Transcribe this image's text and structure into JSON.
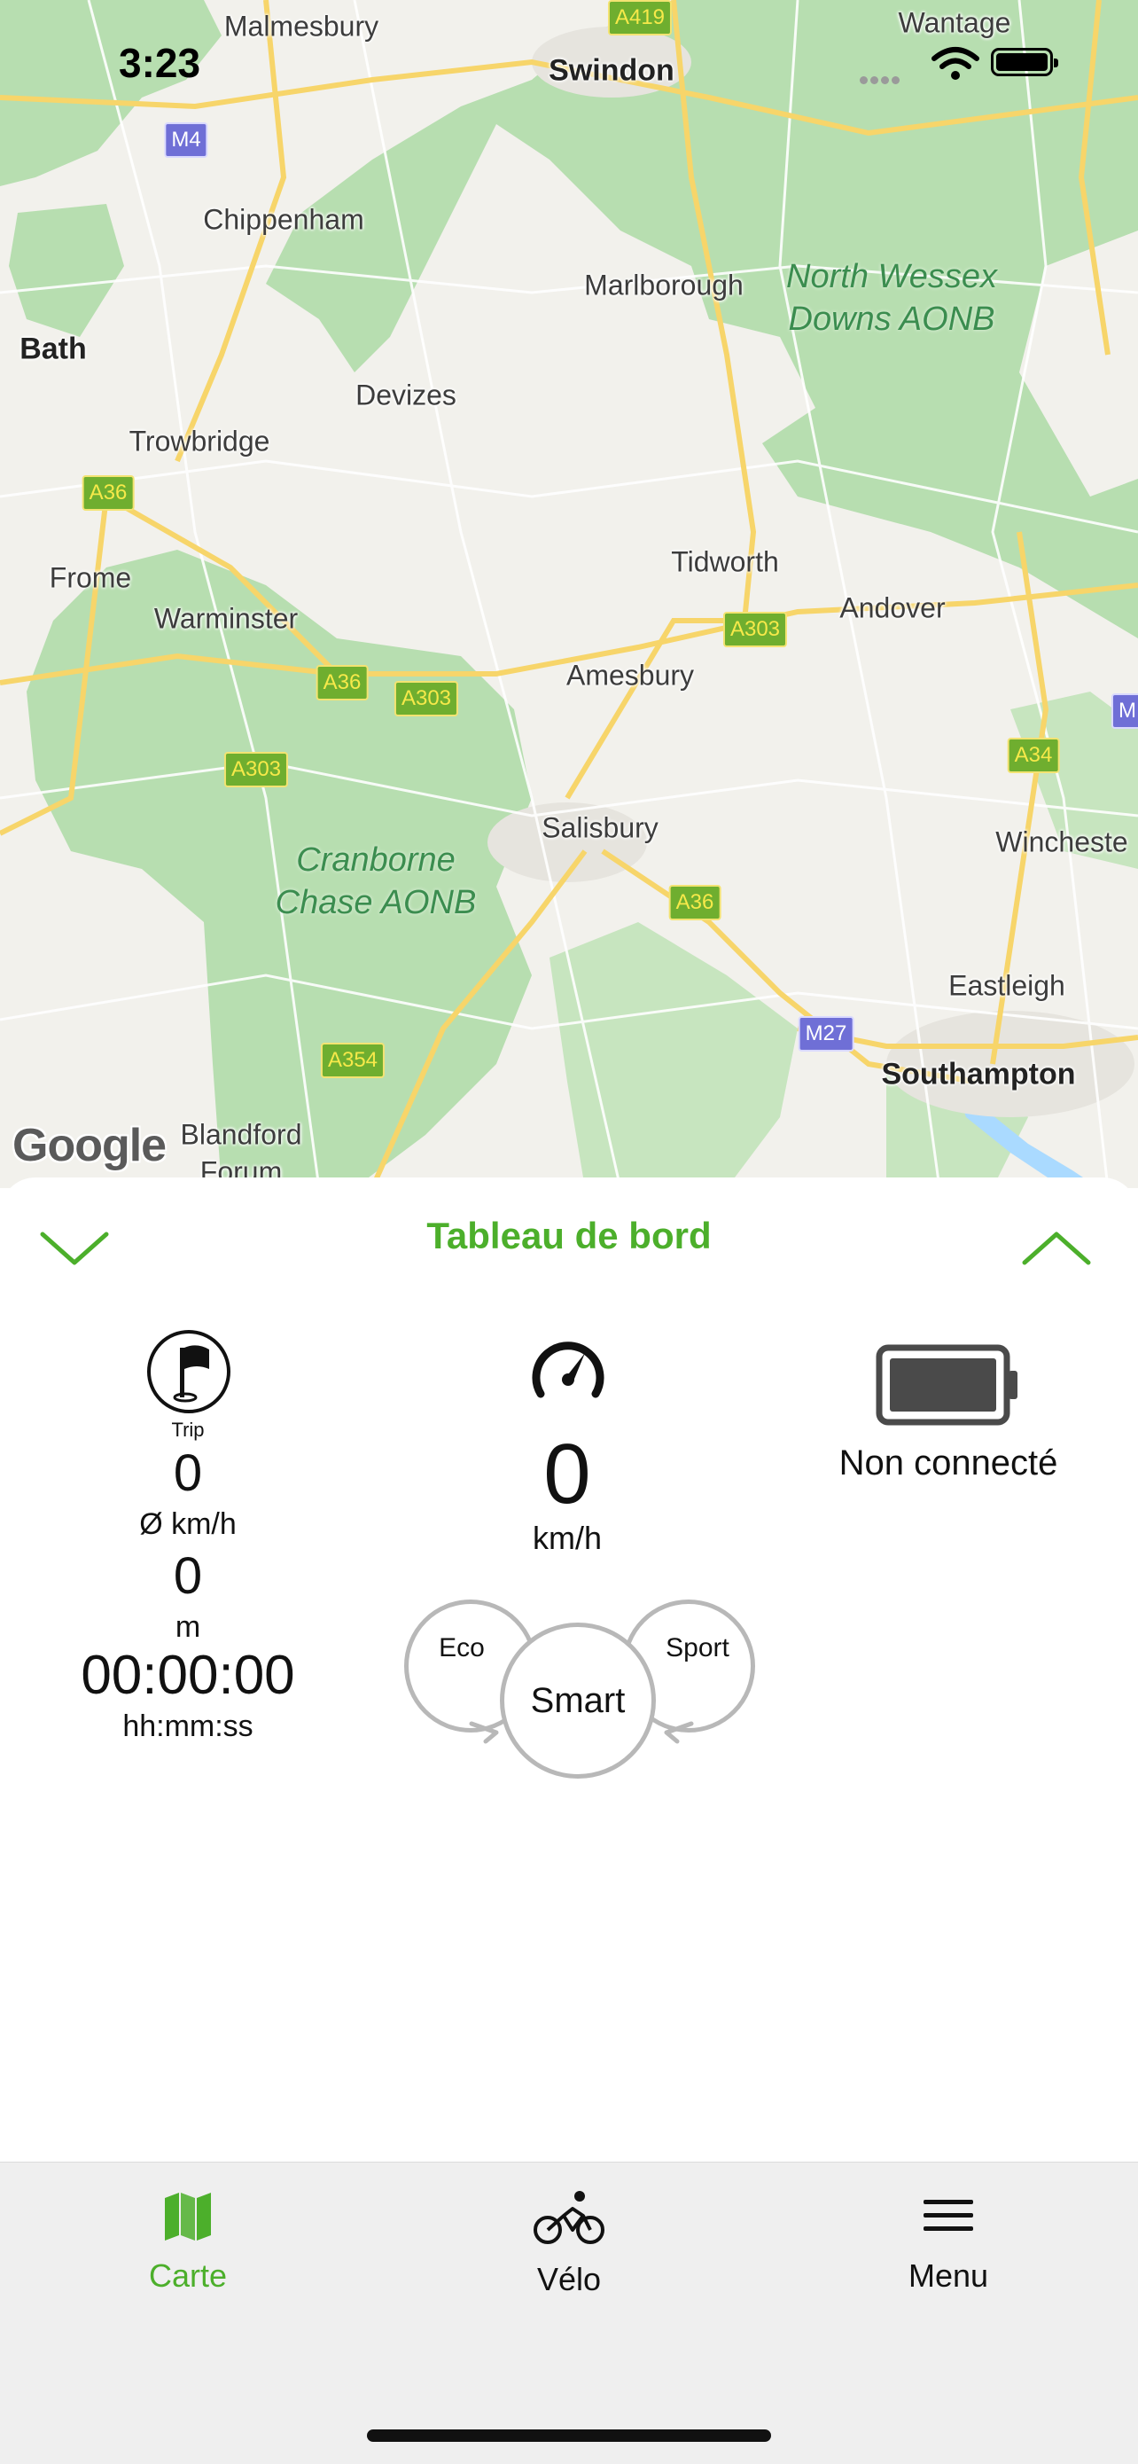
{
  "status_bar": {
    "time": "3:23"
  },
  "map": {
    "attribution": "Google",
    "places": [
      {
        "name": "Malmesbury"
      },
      {
        "name": "Swindon"
      },
      {
        "name": "Wantage"
      },
      {
        "name": "Chippenham"
      },
      {
        "name": "Marlborough"
      },
      {
        "name": "Bath"
      },
      {
        "name": "Devizes"
      },
      {
        "name": "Trowbridge"
      },
      {
        "name": "Tidworth"
      },
      {
        "name": "Frome"
      },
      {
        "name": "Warminster"
      },
      {
        "name": "Andover"
      },
      {
        "name": "Amesbury"
      },
      {
        "name": "Salisbury"
      },
      {
        "name": "Wincheste"
      },
      {
        "name": "Eastleigh"
      },
      {
        "name": "Southampton"
      },
      {
        "name": "Blandford"
      },
      {
        "name": "Forum"
      }
    ],
    "areas": [
      {
        "line1": "North Wessex",
        "line2": "Downs AONB"
      },
      {
        "line1": "Cranborne",
        "line2": "Chase AONB"
      }
    ],
    "roads": [
      "A419",
      "M4",
      "A36",
      "A303",
      "A36",
      "A303",
      "A303",
      "A36",
      "A34",
      "M27",
      "A354",
      "M"
    ]
  },
  "sheet": {
    "title": "Tableau de bord",
    "trip": {
      "label": "Trip",
      "avg_speed": "0",
      "avg_speed_unit": "Ø km/h",
      "distance": "0",
      "distance_unit": "m",
      "duration": "00:00:00",
      "duration_unit": "hh:mm:ss"
    },
    "speed": {
      "value": "0",
      "unit": "km/h"
    },
    "battery": {
      "status": "Non connecté"
    },
    "modes": {
      "eco": "Eco",
      "smart": "Smart",
      "sport": "Sport"
    }
  },
  "tabs": [
    {
      "label": "Carte",
      "active": true,
      "icon": "map-icon"
    },
    {
      "label": "Vélo",
      "active": false,
      "icon": "bike-icon"
    },
    {
      "label": "Menu",
      "active": false,
      "icon": "hamburger-icon"
    }
  ],
  "colors": {
    "accent": "#4caf2b",
    "park": "#b7deb0",
    "road": "#f7d56a"
  }
}
